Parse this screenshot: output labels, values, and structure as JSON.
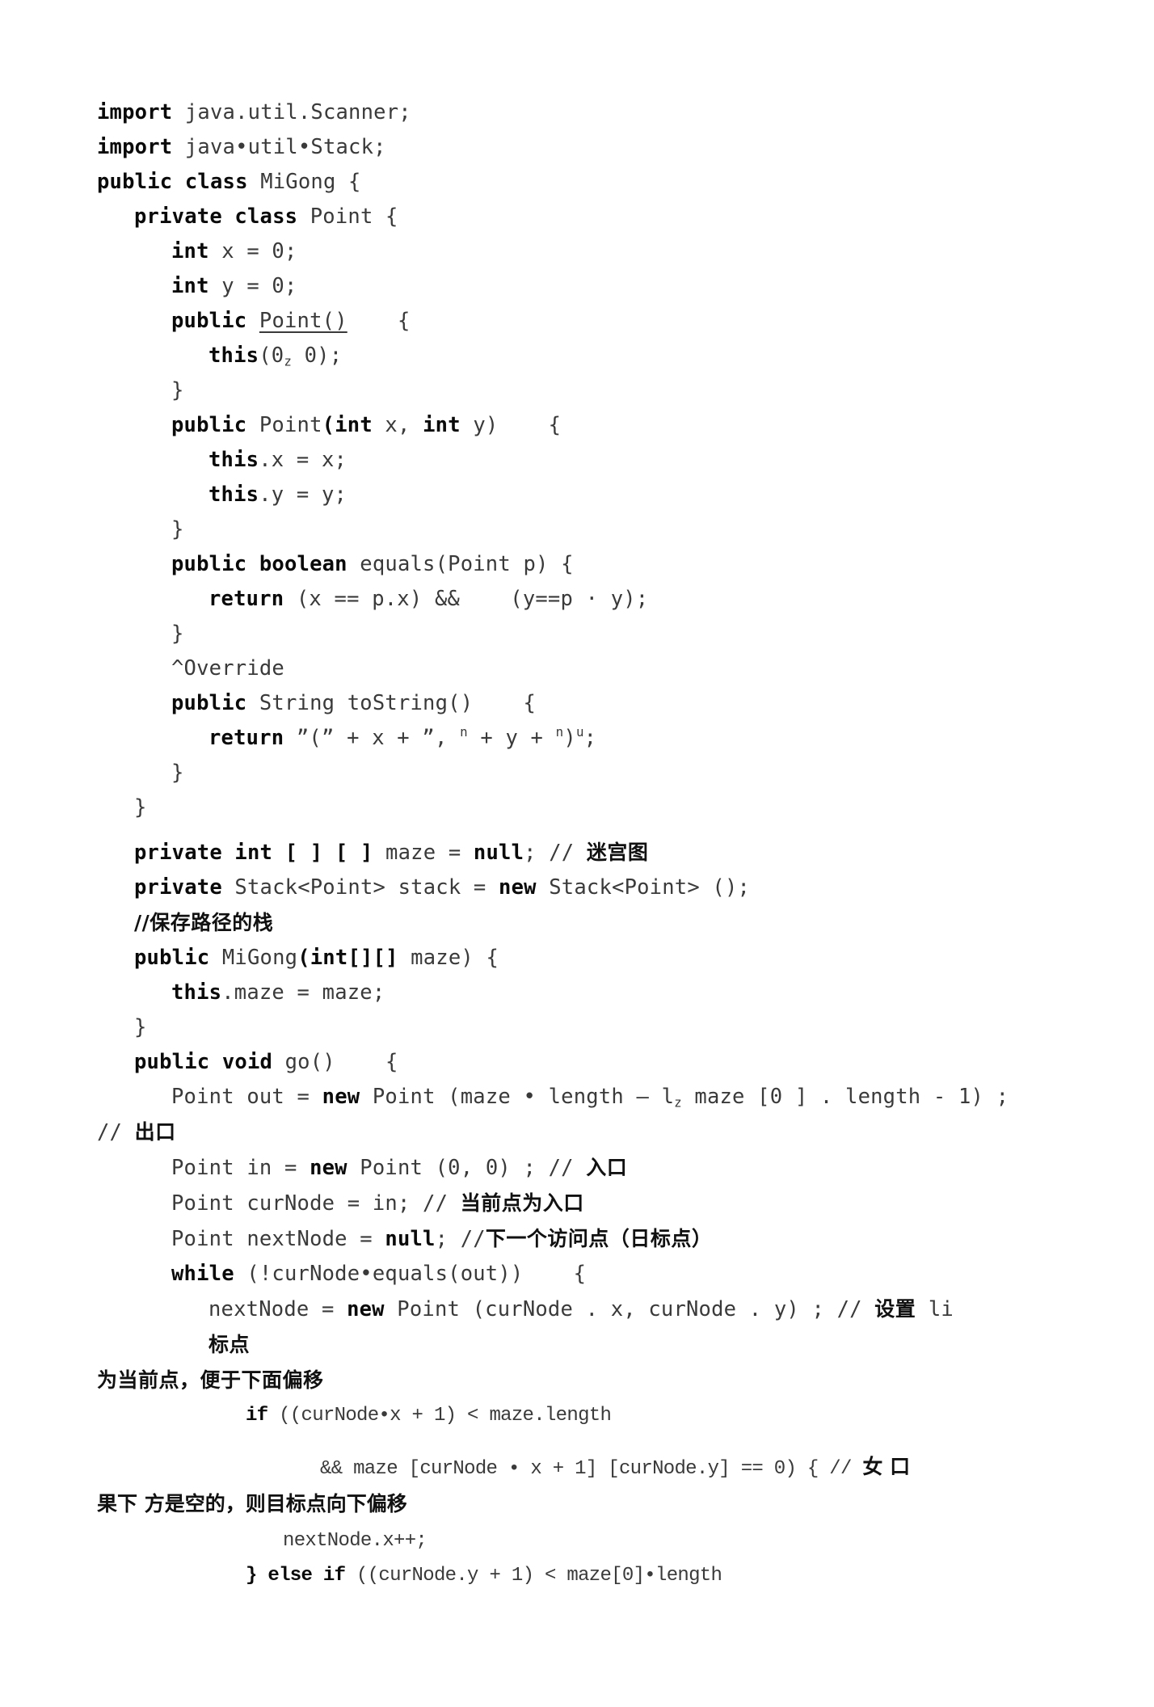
{
  "document": {
    "kind": "scanned-java-source-listing",
    "language": "Java",
    "class_name": "MiGong",
    "page_background": "#ffffff",
    "text_color": "#2b2b2b",
    "keyword_color": "#0a0a0a"
  },
  "code": {
    "l01": {
      "kw1": "import",
      "rest": " java.util.Scanner;"
    },
    "l02": {
      "kw1": "import",
      "rest": " java•util•Stack;"
    },
    "l03": {
      "kw1": "public class",
      "rest": " MiGong {"
    },
    "l04": {
      "kw1": "private class",
      "rest": " Point {"
    },
    "l05": {
      "kw1": "int",
      "rest": " x = 0;"
    },
    "l06": {
      "kw1": "int",
      "rest": " y = 0;"
    },
    "l07": {
      "kw1": "public",
      "name": "Point()",
      "rest": "    {"
    },
    "l08": {
      "kw1": "this",
      "pre": "(0",
      "sub": "z",
      "rest": " 0);"
    },
    "l09": {
      "rest": "}"
    },
    "l10": {
      "kw1": "public",
      "mid": " Point",
      "kw2": "(int",
      "mid2": " x, ",
      "kw3": "int",
      "rest": " y)    {"
    },
    "l11": {
      "kw1": "this",
      "rest": ".x = x;"
    },
    "l12": {
      "kw1": "this",
      "rest": ".y = y;"
    },
    "l13": {
      "rest": "}"
    },
    "l14": {
      "kw1": "public boolean",
      "rest": " equals(Point p) {"
    },
    "l15": {
      "kw1": "return",
      "rest": " (x == p.x) &&    (y==p · y);"
    },
    "l16": {
      "rest": "}"
    },
    "l17": {
      "rest": "^Override"
    },
    "l18": {
      "kw1": "public",
      "rest": " String toString()    {"
    },
    "l19": {
      "kw1": "return",
      "p1": " ”(” + x + ”, ",
      "s1": "n",
      "p2": " + y + ",
      "s2": "n",
      "p3": ")",
      "s3": "u",
      "p4": ";"
    },
    "l20": {
      "rest": "}"
    },
    "l21": {
      "rest": "}"
    },
    "l22": {
      "kw1": "private int [ ] [ ]",
      "mid": " maze = ",
      "kw2": "null",
      "mid2": "; // ",
      "cn": "迷宫图"
    },
    "l23": {
      "kw1": "private",
      "mid": " Stack<Point> stack = ",
      "kw2": "new",
      "rest": " Stack<Point> ();"
    },
    "l24": {
      "cn": "//保存路径的栈"
    },
    "l25": {
      "kw1": "public",
      "mid": " MiGong",
      "kw2": "(int[][]",
      "rest": " maze) {"
    },
    "l26": {
      "kw1": "this",
      "rest": ".maze = maze;"
    },
    "l27": {
      "rest": "}"
    },
    "l28": {
      "kw1": "public void",
      "rest": " go()    {"
    },
    "l29": {
      "pre": "Point out = ",
      "kw1": "new",
      "p1": " Point (maze • length — l",
      "sub": "z",
      "p2": " maze [0 ] . length - 1) ;"
    },
    "l30": {
      "pre": "// ",
      "cn": "出口"
    },
    "l31": {
      "pre": "Point in = ",
      "kw1": "new",
      "p1": " Point (0, 0) ; // ",
      "cn": "入口"
    },
    "l32": {
      "pre": "Point curNode = in; // ",
      "cn": "当前点为入口"
    },
    "l33": {
      "pre": "Point nextNode = ",
      "kw1": "null",
      "p1": "; //",
      "cn": "下一个访问点（日标点）"
    },
    "l34": {
      "kw1": "while",
      "rest": " (!curNode•equals(out))    {"
    },
    "l35": {
      "pre": "nextNode = ",
      "kw1": "new",
      "p1": " Point (curNode . x, curNode . y) ; // ",
      "cn": "设置",
      "p2": " li"
    },
    "l36": {
      "cn": "标点"
    },
    "l37": {
      "cn": "为当前点，便于下面偏移"
    },
    "l38": {
      "kw1": "if",
      "rest": " ((curNode•x + 1) < maze.length"
    },
    "l39": {
      "pre": "&& maze [curNode • x + 1] [curNode.y] == 0) { // ",
      "cn": "女 口"
    },
    "l40": {
      "cn": "果下 方是空的，则目标点向下偏移"
    },
    "l41": {
      "rest": "nextNode.x++;"
    },
    "l42": {
      "kw1": "} else if",
      "rest": " ((curNode.y + 1) < maze[0]•length"
    }
  }
}
